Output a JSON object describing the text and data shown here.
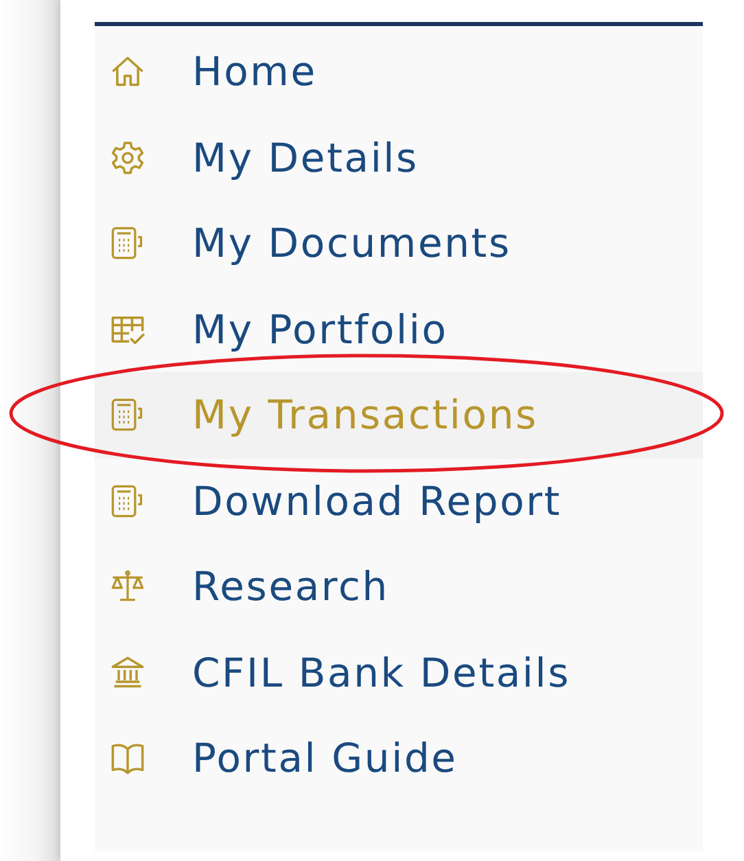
{
  "menu": {
    "items": [
      {
        "label": "Home",
        "kind": "home",
        "selected": false
      },
      {
        "label": "My Details",
        "kind": "settings",
        "selected": false
      },
      {
        "label": "My Documents",
        "kind": "document",
        "selected": false
      },
      {
        "label": "My Portfolio",
        "kind": "portfolio",
        "selected": false
      },
      {
        "label": "My Transactions",
        "kind": "document",
        "selected": true
      },
      {
        "label": "Download Report",
        "kind": "document",
        "selected": false
      },
      {
        "label": "Research",
        "kind": "research",
        "selected": false
      },
      {
        "label": "CFIL Bank Details",
        "kind": "bank",
        "selected": false
      },
      {
        "label": "Portal Guide",
        "kind": "guide",
        "selected": false
      }
    ]
  }
}
